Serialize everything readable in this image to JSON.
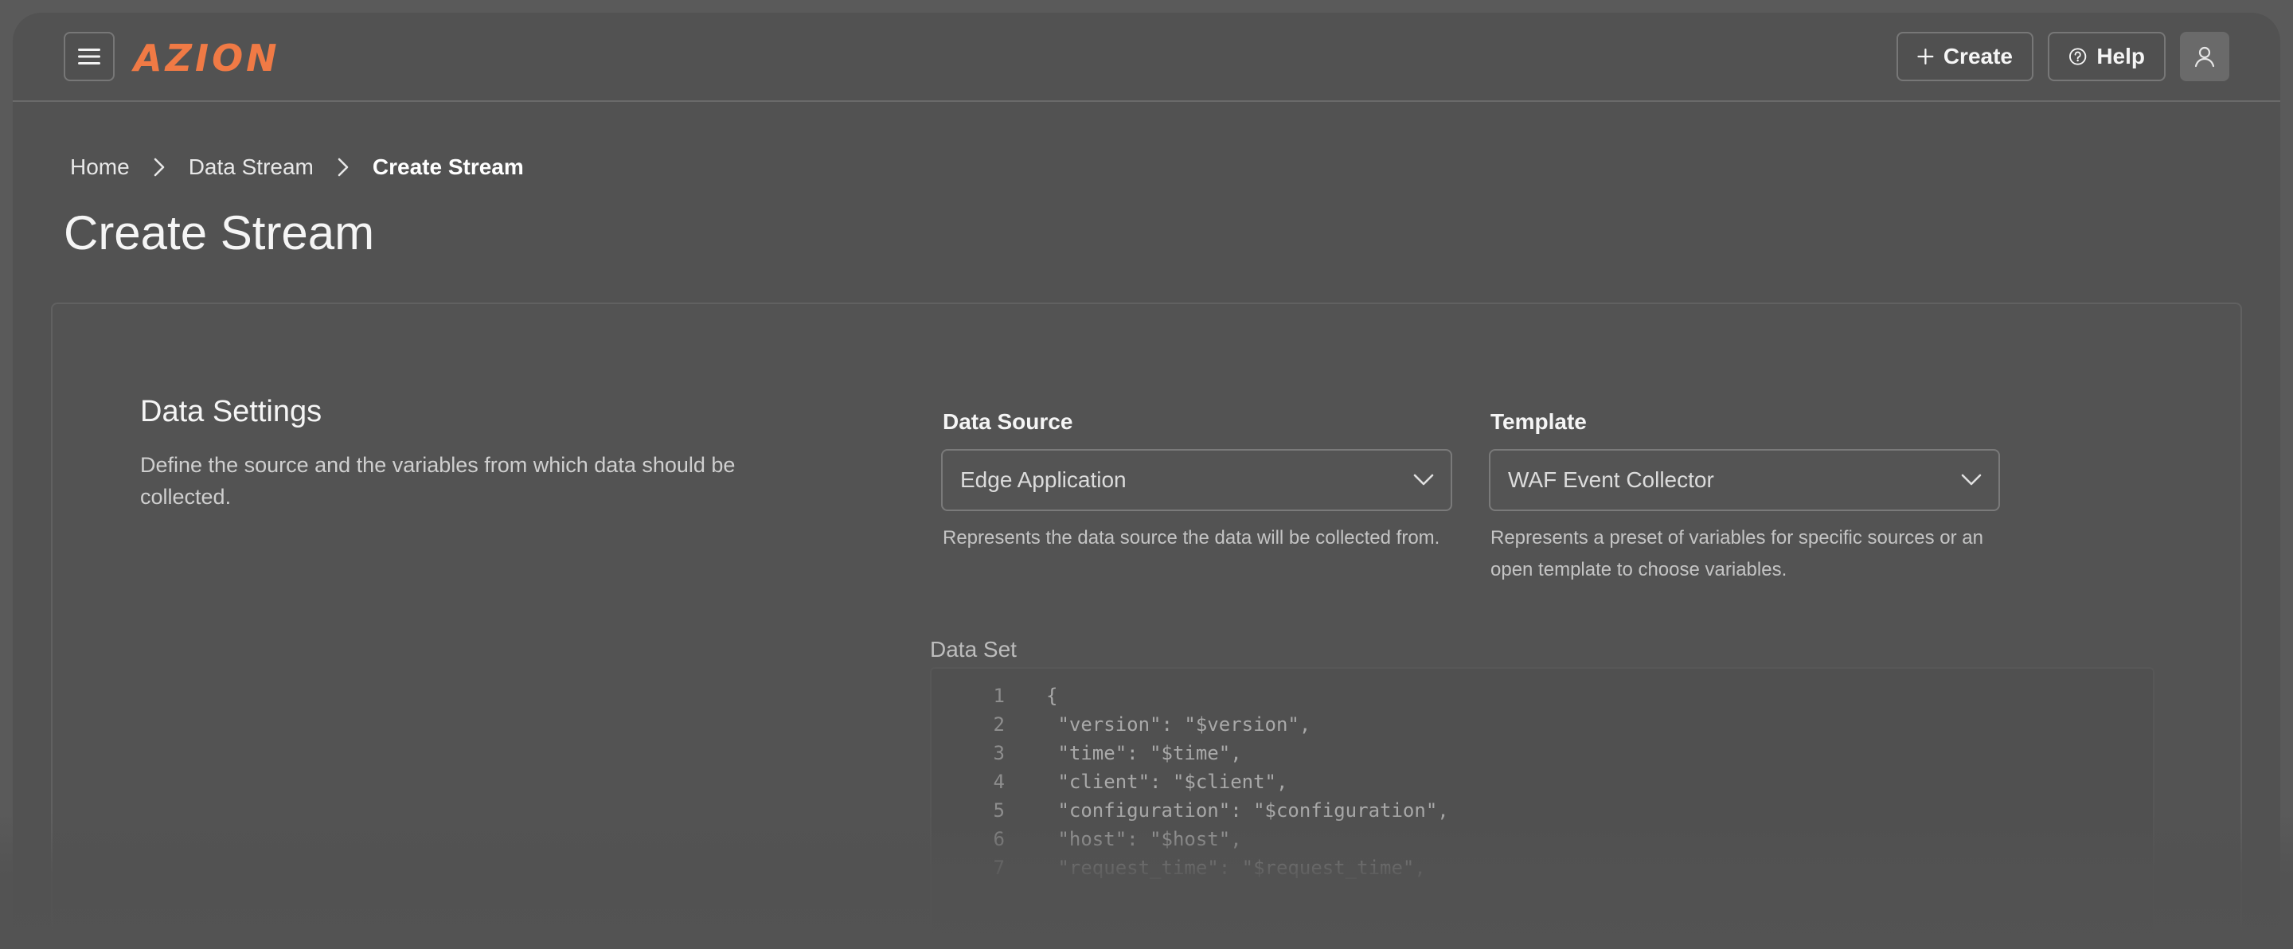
{
  "header": {
    "logo_text": "AZION",
    "create_label": "Create",
    "help_label": "Help"
  },
  "breadcrumb": [
    "Home",
    "Data Stream",
    "Create Stream"
  ],
  "page_title": "Create Stream",
  "section": {
    "title": "Data Settings",
    "description": "Define the source and the variables from which data should be collected."
  },
  "data_source": {
    "label": "Data Source",
    "value": "Edge Application",
    "hint": "Represents the data source the data will be collected from."
  },
  "template": {
    "label": "Template",
    "value": "WAF Event Collector",
    "hint": "Represents a preset of variables for specific sources or an open template to choose variables."
  },
  "data_set": {
    "label": "Data Set",
    "lines": [
      {
        "num": "1",
        "text": "{"
      },
      {
        "num": "2",
        "text": " \"version\": \"$version\","
      },
      {
        "num": "3",
        "text": " \"time\": \"$time\","
      },
      {
        "num": "4",
        "text": " \"client\": \"$client\","
      },
      {
        "num": "5",
        "text": " \"configuration\": \"$configuration\","
      },
      {
        "num": "6",
        "text": " \"host\": \"$host\","
      },
      {
        "num": "7",
        "text": " \"request_time\": \"$request_time\","
      }
    ]
  },
  "colors": {
    "brand": "#f07a45",
    "background": "#525252"
  }
}
